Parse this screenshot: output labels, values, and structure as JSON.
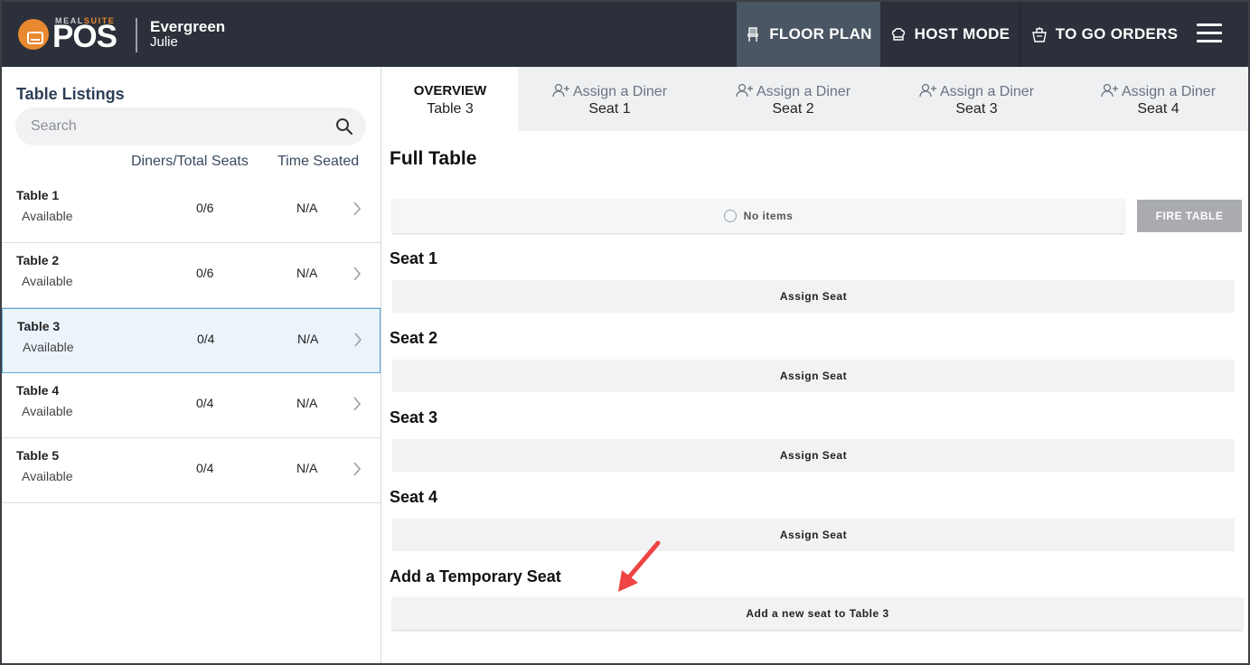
{
  "header": {
    "logo": {
      "small_left": "MEAL",
      "small_right": "SUITE",
      "big": "POS"
    },
    "venue_name": "Evergreen",
    "user_name": "Julie",
    "nav": [
      {
        "label": "FLOOR PLAN",
        "icon": "chair-icon",
        "active": true
      },
      {
        "label": "HOST MODE",
        "icon": "chef-hat-icon",
        "active": false
      },
      {
        "label": "TO GO ORDERS",
        "icon": "takeout-icon",
        "active": false
      }
    ],
    "menu_icon": "hamburger-menu-icon"
  },
  "colors": {
    "topbar": "#2b303a",
    "active_nav": "#4a5664",
    "logo_accent": "#e9892f",
    "selected_row": "#ebf4fb",
    "selected_border": "#58a8d8",
    "fire_button": "#a9abae",
    "arrow": "#ee4444"
  },
  "left": {
    "title": "Table Listings",
    "search_placeholder": "Search",
    "columns": {
      "diners": "Diners/Total Seats",
      "time": "Time Seated"
    },
    "tables": [
      {
        "name": "Table 1",
        "status": "Available",
        "diners": "0/6",
        "time": "N/A",
        "selected": false
      },
      {
        "name": "Table 2",
        "status": "Available",
        "diners": "0/6",
        "time": "N/A",
        "selected": false
      },
      {
        "name": "Table 3",
        "status": "Available",
        "diners": "0/4",
        "time": "N/A",
        "selected": true
      },
      {
        "name": "Table 4",
        "status": "Available",
        "diners": "0/4",
        "time": "N/A",
        "selected": false
      },
      {
        "name": "Table 5",
        "status": "Available",
        "diners": "0/4",
        "time": "N/A",
        "selected": false
      }
    ]
  },
  "right": {
    "tabs": [
      {
        "top": "OVERVIEW",
        "bottom": "Table 3",
        "active": true
      },
      {
        "top": "Assign a Diner",
        "bottom": "Seat 1",
        "active": false
      },
      {
        "top": "Assign a Diner",
        "bottom": "Seat 2",
        "active": false
      },
      {
        "top": "Assign a Diner",
        "bottom": "Seat 3",
        "active": false
      },
      {
        "top": "Assign a Diner",
        "bottom": "Seat 4",
        "active": false
      }
    ],
    "full_table": {
      "title": "Full Table",
      "no_items": "No items",
      "fire_label": "FIRE TABLE"
    },
    "seats": [
      {
        "title": "Seat 1",
        "action": "Assign Seat"
      },
      {
        "title": "Seat 2",
        "action": "Assign Seat"
      },
      {
        "title": "Seat 3",
        "action": "Assign Seat"
      },
      {
        "title": "Seat 4",
        "action": "Assign Seat"
      }
    ],
    "temp_seat": {
      "title": "Add a Temporary Seat",
      "action": "Add a new seat to Table 3"
    }
  }
}
